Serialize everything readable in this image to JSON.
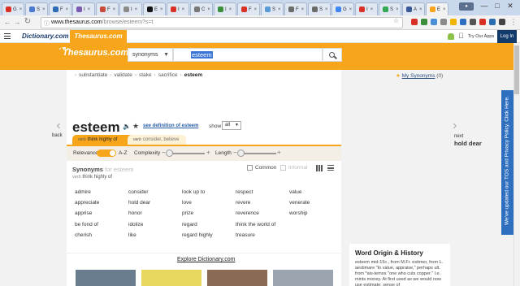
{
  "browser": {
    "tabs": [
      {
        "label": "G",
        "color": "#d93025"
      },
      {
        "label": "S",
        "color": "#4a7bd0"
      },
      {
        "label": "F",
        "color": "#2a6db0"
      },
      {
        "label": "I",
        "color": "#7a5bb0"
      },
      {
        "label": "F",
        "color": "#c84a3a"
      },
      {
        "label": "I",
        "color": "#8a8a8a"
      },
      {
        "label": "E",
        "color": "#111111"
      },
      {
        "label": "I",
        "color": "#d93025"
      },
      {
        "label": "C",
        "color": "#777777"
      },
      {
        "label": "I",
        "color": "#3b8f3b"
      },
      {
        "label": "F",
        "color": "#d93025"
      },
      {
        "label": "S",
        "color": "#5a9bd5"
      },
      {
        "label": "F",
        "color": "#6b6b6b"
      },
      {
        "label": "S",
        "color": "#6b6b6b"
      },
      {
        "label": "G",
        "color": "#4285f4"
      },
      {
        "label": "I",
        "color": "#d93025"
      },
      {
        "label": "S",
        "color": "#34a853"
      },
      {
        "label": "A",
        "color": "#3b5998"
      },
      {
        "label": "E",
        "color": "#f7a61b"
      }
    ],
    "url_host": "www.thesaurus.com",
    "url_path": "/browse/esteem?s=t"
  },
  "dictbar": {
    "dictionary_logo": "Dictionary.com",
    "thesaurus_tab": "Thesaurus.com",
    "try_apps": "Try Our Apps",
    "login": "Log In"
  },
  "search": {
    "logo": "Thesaurus.com",
    "type": "synonyms",
    "query": "esteem"
  },
  "breadcrumbs": [
    "substantiate",
    "validate",
    "stake",
    "sacrifice",
    "esteem"
  ],
  "my_synonyms": {
    "label": "My Synonyms",
    "count": "(0)"
  },
  "entry": {
    "word": "esteem",
    "see_definition": "see definition of esteem",
    "show_label": "show",
    "show_value": "all",
    "back": "back",
    "next": "next",
    "next_word": "hold dear"
  },
  "senses": [
    {
      "pos": "verb",
      "label": "think highly of"
    },
    {
      "pos": "verb",
      "label": "consider, believe"
    }
  ],
  "filters": {
    "relevance": "Relevance",
    "az": "A-Z",
    "complexity": "Complexity",
    "length": "Length"
  },
  "synonyms": {
    "heading": "Synonyms",
    "heading_for": "for esteem",
    "sub_pos": "verb",
    "sub_label": "think highly of",
    "common": "Common",
    "informal": "Informal",
    "columns": [
      [
        "admire",
        "appreciate",
        "apprise",
        "be fond of",
        "cherish"
      ],
      [
        "consider",
        "hold dear",
        "honor",
        "idolize",
        "like"
      ],
      [
        "look up to",
        "love",
        "prize",
        "regard",
        "regard highly"
      ],
      [
        "respect",
        "revere",
        "reverence",
        "think the world of",
        "treasure"
      ],
      [
        "value",
        "venerate",
        "worship"
      ]
    ]
  },
  "explore": {
    "title": "Explore Dictionary.com"
  },
  "origin": {
    "title": "Word Origin & History",
    "text": "esteem mid-15c., from M.Fr. estimer, from L. aestimare \"to value, appraise,\" perhaps ult. from *ais-temos \"one who cuts copper.\" I.e. mints money. At first used as we would now use estimate; sense of"
  },
  "notice": "We've updated our TOS and Privacy Policy. Click Here.",
  "colors": {
    "brand_orange": "#f7a61b",
    "navy": "#123a6b",
    "notice_blue": "#2f6fbf"
  }
}
